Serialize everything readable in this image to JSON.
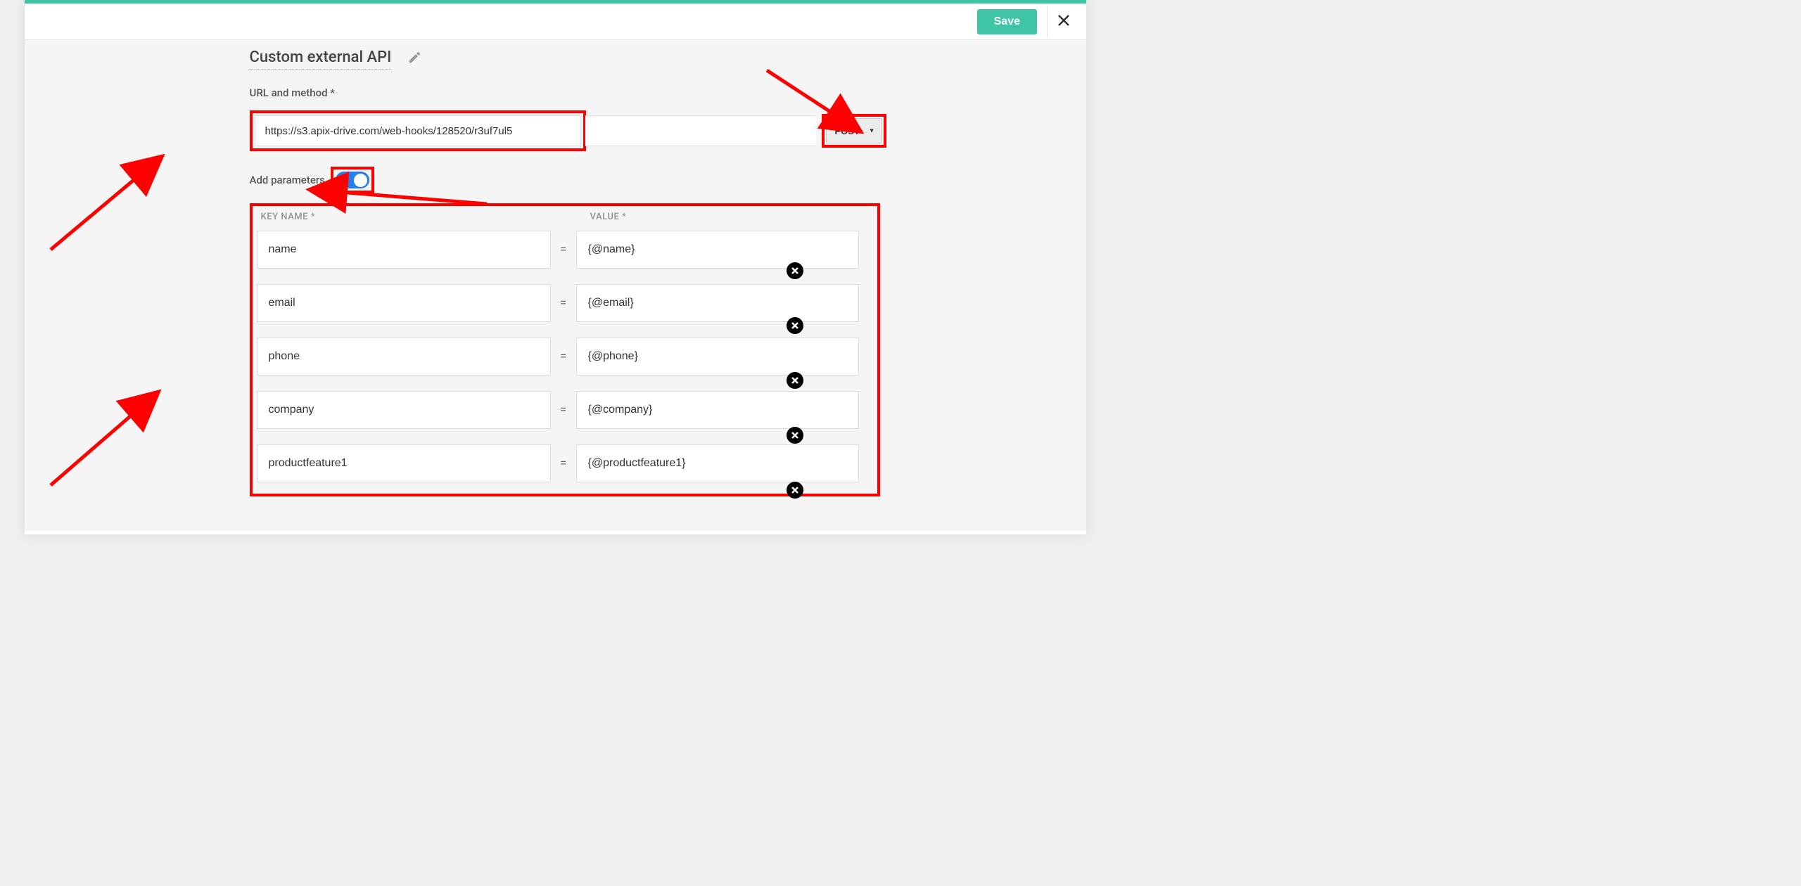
{
  "header": {
    "save_label": "Save"
  },
  "title": "Custom external API",
  "url_section_label": "URL and method *",
  "url_value": "https://s3.apix-drive.com/web-hooks/128520/r3uf7ul5",
  "method_selected": "POST",
  "add_params_label": "Add parameters",
  "params_header": {
    "key": "KEY NAME *",
    "value": "VALUE *"
  },
  "params": [
    {
      "key": "name",
      "value": "{@name}"
    },
    {
      "key": "email",
      "value": "{@email}"
    },
    {
      "key": "phone",
      "value": "{@phone}"
    },
    {
      "key": "company",
      "value": "{@company}"
    },
    {
      "key": "productfeature1",
      "value": "{@productfeature1}"
    }
  ]
}
